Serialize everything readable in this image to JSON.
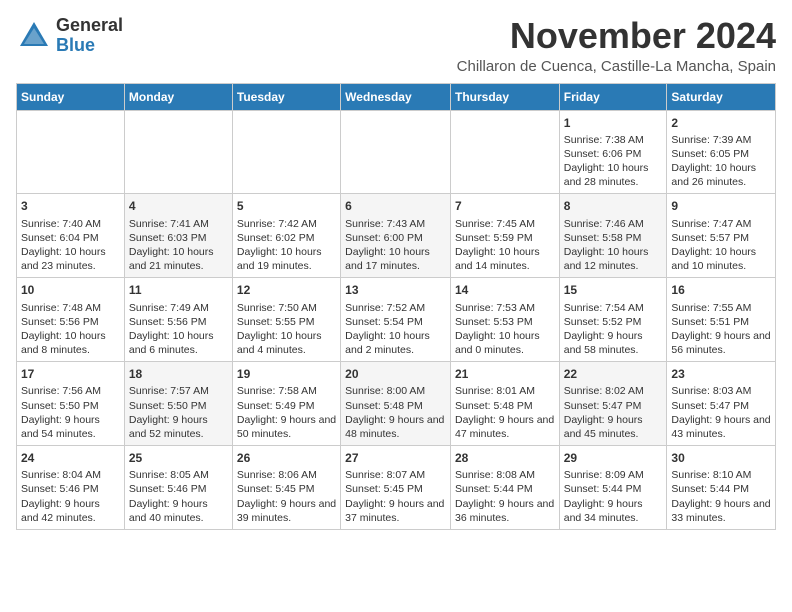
{
  "header": {
    "logo_general": "General",
    "logo_blue": "Blue",
    "month": "November 2024",
    "location": "Chillaron de Cuenca, Castille-La Mancha, Spain"
  },
  "days_of_week": [
    "Sunday",
    "Monday",
    "Tuesday",
    "Wednesday",
    "Thursday",
    "Friday",
    "Saturday"
  ],
  "weeks": [
    [
      {
        "day": "",
        "sunrise": "",
        "sunset": "",
        "daylight": ""
      },
      {
        "day": "",
        "sunrise": "",
        "sunset": "",
        "daylight": ""
      },
      {
        "day": "",
        "sunrise": "",
        "sunset": "",
        "daylight": ""
      },
      {
        "day": "",
        "sunrise": "",
        "sunset": "",
        "daylight": ""
      },
      {
        "day": "",
        "sunrise": "",
        "sunset": "",
        "daylight": ""
      },
      {
        "day": "1",
        "sunrise": "Sunrise: 7:38 AM",
        "sunset": "Sunset: 6:06 PM",
        "daylight": "Daylight: 10 hours and 28 minutes."
      },
      {
        "day": "2",
        "sunrise": "Sunrise: 7:39 AM",
        "sunset": "Sunset: 6:05 PM",
        "daylight": "Daylight: 10 hours and 26 minutes."
      }
    ],
    [
      {
        "day": "3",
        "sunrise": "Sunrise: 7:40 AM",
        "sunset": "Sunset: 6:04 PM",
        "daylight": "Daylight: 10 hours and 23 minutes."
      },
      {
        "day": "4",
        "sunrise": "Sunrise: 7:41 AM",
        "sunset": "Sunset: 6:03 PM",
        "daylight": "Daylight: 10 hours and 21 minutes."
      },
      {
        "day": "5",
        "sunrise": "Sunrise: 7:42 AM",
        "sunset": "Sunset: 6:02 PM",
        "daylight": "Daylight: 10 hours and 19 minutes."
      },
      {
        "day": "6",
        "sunrise": "Sunrise: 7:43 AM",
        "sunset": "Sunset: 6:00 PM",
        "daylight": "Daylight: 10 hours and 17 minutes."
      },
      {
        "day": "7",
        "sunrise": "Sunrise: 7:45 AM",
        "sunset": "Sunset: 5:59 PM",
        "daylight": "Daylight: 10 hours and 14 minutes."
      },
      {
        "day": "8",
        "sunrise": "Sunrise: 7:46 AM",
        "sunset": "Sunset: 5:58 PM",
        "daylight": "Daylight: 10 hours and 12 minutes."
      },
      {
        "day": "9",
        "sunrise": "Sunrise: 7:47 AM",
        "sunset": "Sunset: 5:57 PM",
        "daylight": "Daylight: 10 hours and 10 minutes."
      }
    ],
    [
      {
        "day": "10",
        "sunrise": "Sunrise: 7:48 AM",
        "sunset": "Sunset: 5:56 PM",
        "daylight": "Daylight: 10 hours and 8 minutes."
      },
      {
        "day": "11",
        "sunrise": "Sunrise: 7:49 AM",
        "sunset": "Sunset: 5:56 PM",
        "daylight": "Daylight: 10 hours and 6 minutes."
      },
      {
        "day": "12",
        "sunrise": "Sunrise: 7:50 AM",
        "sunset": "Sunset: 5:55 PM",
        "daylight": "Daylight: 10 hours and 4 minutes."
      },
      {
        "day": "13",
        "sunrise": "Sunrise: 7:52 AM",
        "sunset": "Sunset: 5:54 PM",
        "daylight": "Daylight: 10 hours and 2 minutes."
      },
      {
        "day": "14",
        "sunrise": "Sunrise: 7:53 AM",
        "sunset": "Sunset: 5:53 PM",
        "daylight": "Daylight: 10 hours and 0 minutes."
      },
      {
        "day": "15",
        "sunrise": "Sunrise: 7:54 AM",
        "sunset": "Sunset: 5:52 PM",
        "daylight": "Daylight: 9 hours and 58 minutes."
      },
      {
        "day": "16",
        "sunrise": "Sunrise: 7:55 AM",
        "sunset": "Sunset: 5:51 PM",
        "daylight": "Daylight: 9 hours and 56 minutes."
      }
    ],
    [
      {
        "day": "17",
        "sunrise": "Sunrise: 7:56 AM",
        "sunset": "Sunset: 5:50 PM",
        "daylight": "Daylight: 9 hours and 54 minutes."
      },
      {
        "day": "18",
        "sunrise": "Sunrise: 7:57 AM",
        "sunset": "Sunset: 5:50 PM",
        "daylight": "Daylight: 9 hours and 52 minutes."
      },
      {
        "day": "19",
        "sunrise": "Sunrise: 7:58 AM",
        "sunset": "Sunset: 5:49 PM",
        "daylight": "Daylight: 9 hours and 50 minutes."
      },
      {
        "day": "20",
        "sunrise": "Sunrise: 8:00 AM",
        "sunset": "Sunset: 5:48 PM",
        "daylight": "Daylight: 9 hours and 48 minutes."
      },
      {
        "day": "21",
        "sunrise": "Sunrise: 8:01 AM",
        "sunset": "Sunset: 5:48 PM",
        "daylight": "Daylight: 9 hours and 47 minutes."
      },
      {
        "day": "22",
        "sunrise": "Sunrise: 8:02 AM",
        "sunset": "Sunset: 5:47 PM",
        "daylight": "Daylight: 9 hours and 45 minutes."
      },
      {
        "day": "23",
        "sunrise": "Sunrise: 8:03 AM",
        "sunset": "Sunset: 5:47 PM",
        "daylight": "Daylight: 9 hours and 43 minutes."
      }
    ],
    [
      {
        "day": "24",
        "sunrise": "Sunrise: 8:04 AM",
        "sunset": "Sunset: 5:46 PM",
        "daylight": "Daylight: 9 hours and 42 minutes."
      },
      {
        "day": "25",
        "sunrise": "Sunrise: 8:05 AM",
        "sunset": "Sunset: 5:46 PM",
        "daylight": "Daylight: 9 hours and 40 minutes."
      },
      {
        "day": "26",
        "sunrise": "Sunrise: 8:06 AM",
        "sunset": "Sunset: 5:45 PM",
        "daylight": "Daylight: 9 hours and 39 minutes."
      },
      {
        "day": "27",
        "sunrise": "Sunrise: 8:07 AM",
        "sunset": "Sunset: 5:45 PM",
        "daylight": "Daylight: 9 hours and 37 minutes."
      },
      {
        "day": "28",
        "sunrise": "Sunrise: 8:08 AM",
        "sunset": "Sunset: 5:44 PM",
        "daylight": "Daylight: 9 hours and 36 minutes."
      },
      {
        "day": "29",
        "sunrise": "Sunrise: 8:09 AM",
        "sunset": "Sunset: 5:44 PM",
        "daylight": "Daylight: 9 hours and 34 minutes."
      },
      {
        "day": "30",
        "sunrise": "Sunrise: 8:10 AM",
        "sunset": "Sunset: 5:44 PM",
        "daylight": "Daylight: 9 hours and 33 minutes."
      }
    ]
  ]
}
